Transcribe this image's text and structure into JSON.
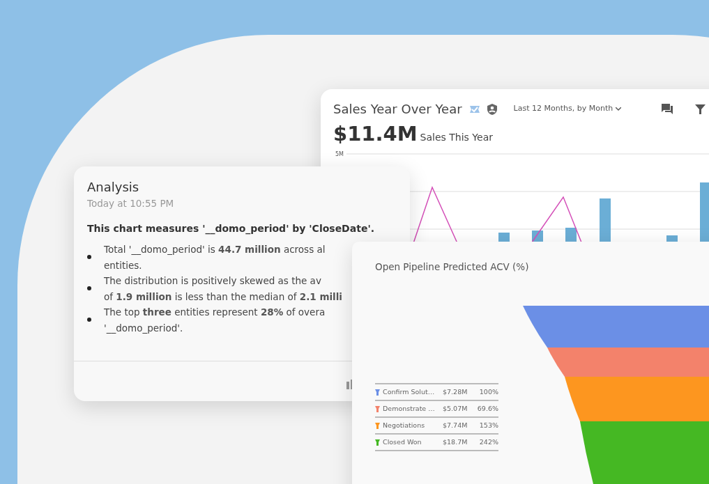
{
  "sales_card": {
    "title": "Sales Year Over Year",
    "date_filter": "Last 12 Months, by Month",
    "total": "$11.4M",
    "total_label": "Sales This Year",
    "y_tick_label": "5M"
  },
  "analysis_card": {
    "title": "Analysis",
    "timestamp": "Today at 10:55 PM",
    "summary": "This chart measures '__domo_period' by 'CloseDate'.",
    "bullets": [
      "Total '__domo_period' is **44.7 million** across al\nentities.",
      "The distribution is positively skewed as the av\nof **1.9 million** is less than the median of **2.1 milli**",
      "The top **three** entities represent **28%** of overa\n'__domo_period'."
    ]
  },
  "pipeline_card": {
    "title": "Open Pipeline Predicted ACV (%)",
    "legend": [
      {
        "stage": "Confirm Solut…",
        "amount": "$7.28M",
        "percent": "100%",
        "color": "#6b8fe6"
      },
      {
        "stage": "Demonstrate …",
        "amount": "$5.07M",
        "percent": "69.6%",
        "color": "#f3826b"
      },
      {
        "stage": "Negotiations",
        "amount": "$7.74M",
        "percent": "153%",
        "color": "#fd961f"
      },
      {
        "stage": "Closed Won",
        "amount": "$18.7M",
        "percent": "242%",
        "color": "#45b823"
      }
    ]
  }
}
